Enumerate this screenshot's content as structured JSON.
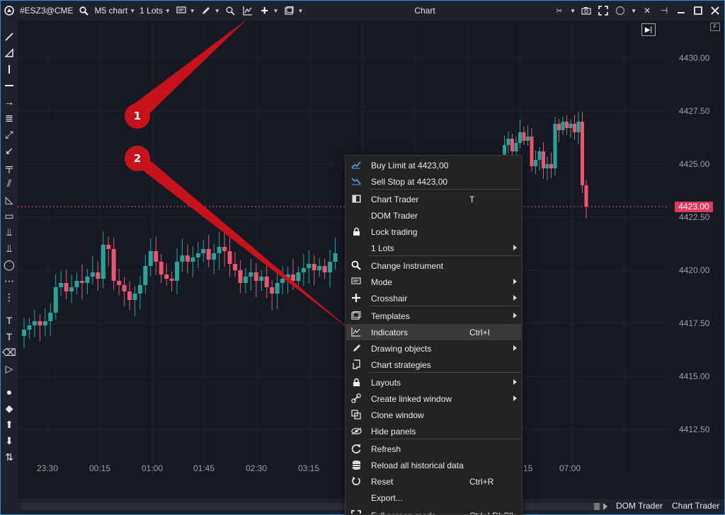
{
  "toolbar": {
    "instrument": "#ESZ3@CME",
    "timeframe": "M5 chart",
    "lots": "1 Lots",
    "window_title": "Chart"
  },
  "price_axis": {
    "labels": [
      "4430.00",
      "4427.50",
      "4425.00",
      "4422.50",
      "4420.00",
      "4417.50",
      "4415.00",
      "4412.50"
    ],
    "last_price": "4423.00"
  },
  "time_axis": {
    "labels": [
      "23:30",
      "00:15",
      "01:00",
      "01:45",
      "02:30",
      "03:15",
      "07:00"
    ],
    "partial": "15"
  },
  "flag": "F",
  "bottom": {
    "dom_trader": "DOM Trader",
    "chart_trader": "Chart Trader"
  },
  "context_menu": {
    "items": [
      {
        "label": "Buy Limit at 4423,00",
        "icon": "buy-limit-icon"
      },
      {
        "label": "Sell Stop at 4423,00",
        "icon": "sell-stop-icon"
      },
      {
        "label": "Chart Trader",
        "shortcut": "T",
        "icon": "chart-trader-icon"
      },
      {
        "label": "DOM Trader",
        "icon": ""
      },
      {
        "label": "Lock trading",
        "icon": "lock-icon"
      },
      {
        "label": "1 Lots",
        "submenu": true,
        "icon": ""
      },
      {
        "label": "Change Instrument",
        "icon": "search-icon"
      },
      {
        "label": "Mode",
        "submenu": true,
        "icon": "mode-icon"
      },
      {
        "label": "Crosshair",
        "submenu": true,
        "icon": "crosshair-icon"
      },
      {
        "label": "Templates",
        "submenu": true,
        "icon": "templates-icon"
      },
      {
        "label": "Indicators",
        "shortcut": "Ctrl+I",
        "icon": "indicators-icon"
      },
      {
        "label": "Drawing objects",
        "submenu": true,
        "icon": "pencil-icon"
      },
      {
        "label": "Chart strategies",
        "icon": "strategies-icon"
      },
      {
        "label": "Layouts",
        "submenu": true,
        "icon": "lock-icon"
      },
      {
        "label": "Create linked window",
        "submenu": true,
        "icon": "link-icon"
      },
      {
        "label": "Clone window",
        "icon": "clone-icon"
      },
      {
        "label": "Hide panels",
        "icon": "eye-icon"
      },
      {
        "label": "Refresh",
        "icon": "refresh-icon"
      },
      {
        "label": "Reload all historical data",
        "icon": "database-icon"
      },
      {
        "label": "Reset",
        "shortcut": "Ctrl+R",
        "icon": "reset-icon"
      },
      {
        "label": "Export...",
        "icon": ""
      },
      {
        "label": "Full screen mode",
        "shortcut": "Ctrl+LDbClk",
        "icon": "fullscreen-icon"
      }
    ]
  },
  "callouts": [
    "1",
    "2"
  ],
  "colors": {
    "bull": "#26a69a",
    "bear": "#ef5370",
    "callout": "#c8121a",
    "background": "#131722"
  }
}
